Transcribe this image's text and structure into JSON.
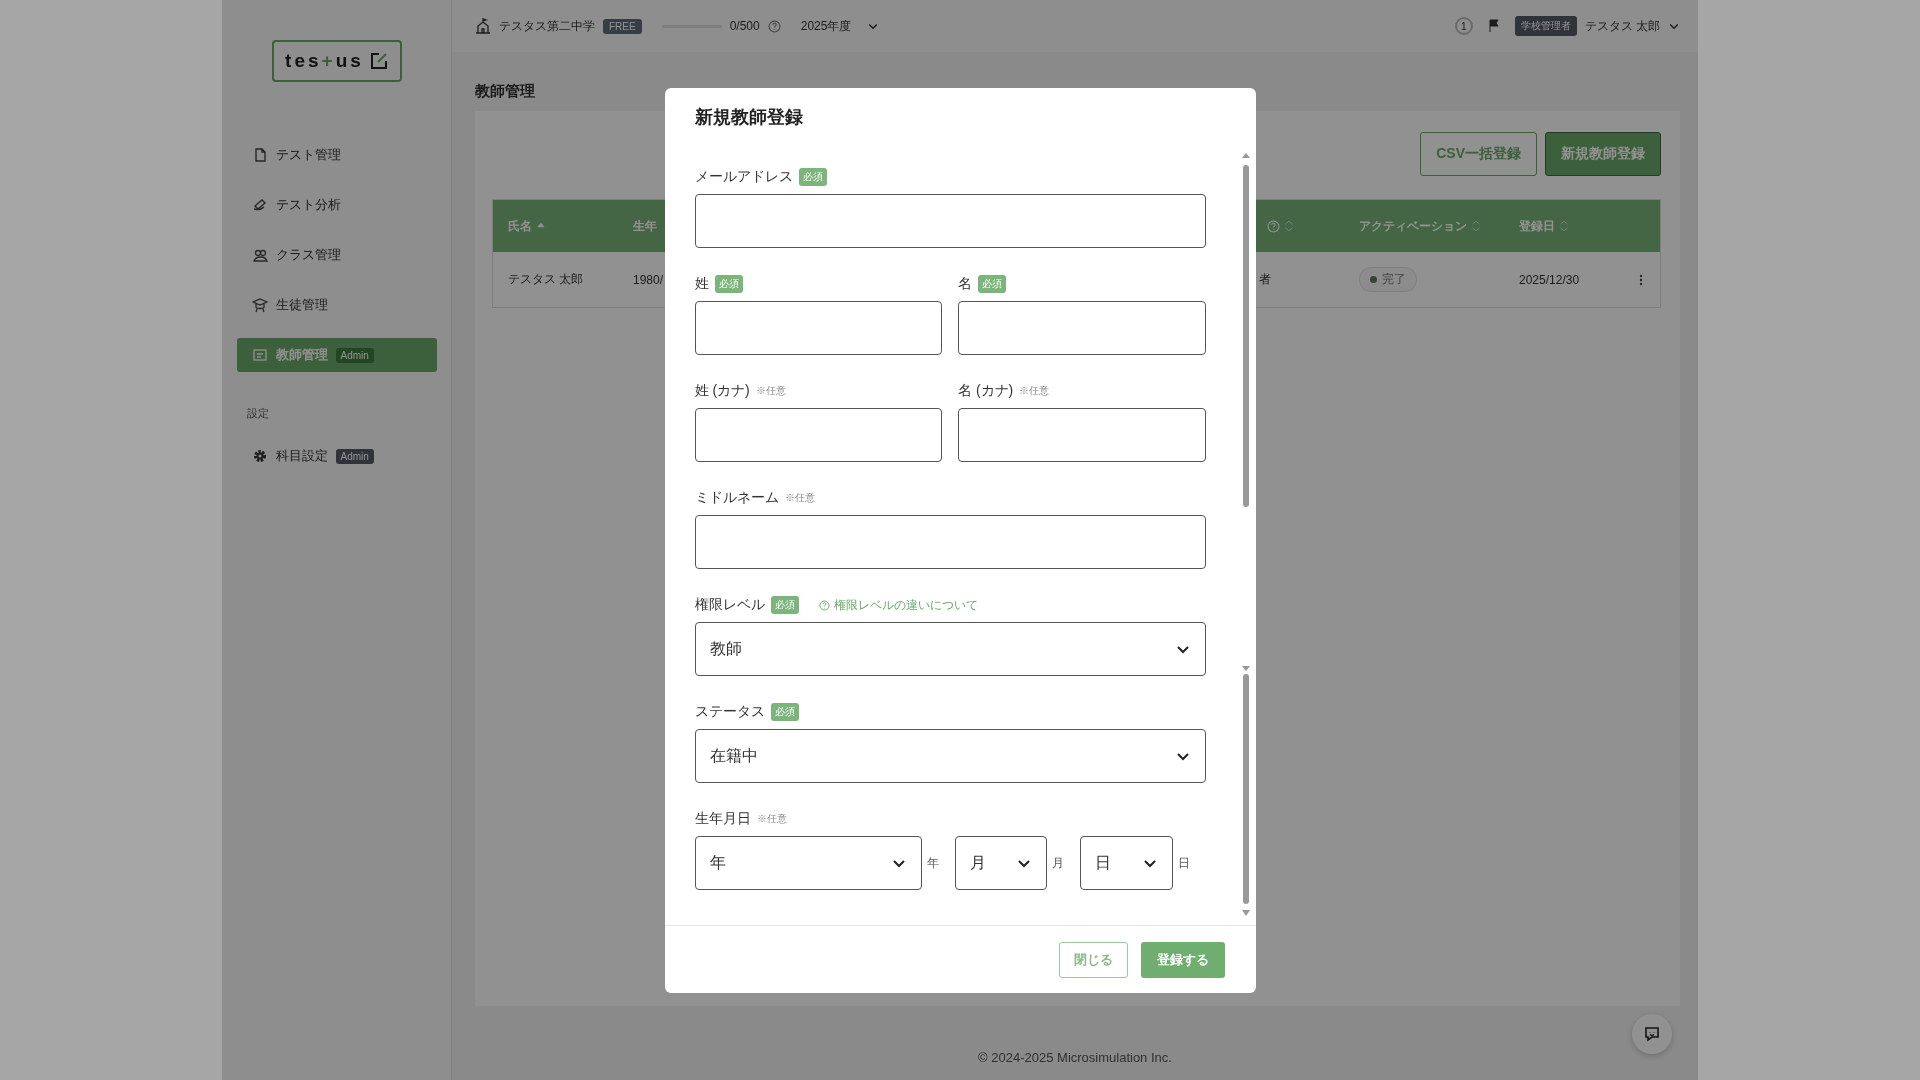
{
  "topbar": {
    "school": "テスタス第二中学",
    "plan": "FREE",
    "usage": {
      "level": 0,
      "reading": "0/500"
    },
    "year": "2025年度",
    "notifications": "1",
    "role": "学校管理者",
    "user": "テスタス 太郎"
  },
  "sidebar": {
    "logo": {
      "text": "tes",
      "accent": "+",
      "rest": "us"
    },
    "items": [
      {
        "label": "テスト管理",
        "selected": false
      },
      {
        "label": "テスト分析",
        "selected": false
      },
      {
        "label": "クラス管理",
        "selected": false
      },
      {
        "label": "生徒管理",
        "selected": false
      },
      {
        "label": "教師管理",
        "selected": true,
        "badge": "Admin"
      }
    ],
    "section": "設定",
    "settings": [
      {
        "label": "科目設定",
        "selected": false,
        "badge": "Admin"
      }
    ]
  },
  "page": {
    "title": "教師管理",
    "buttons": [
      {
        "label": "CSV一括登録",
        "kind": "secondary"
      },
      {
        "label": "新規教師登録",
        "kind": "primary"
      }
    ],
    "table": {
      "columns": [
        {
          "label": "氏名",
          "sorted": true
        },
        {
          "label": "生年"
        },
        {
          "kind": "help",
          "sorted": false
        },
        {
          "label": "アクティベーション",
          "sorted": false
        },
        {
          "label": "登録日",
          "sorted": false
        }
      ],
      "rows": [
        {
          "cells": [
            "テスタス 太郎",
            "1980/",
            "者"
          ],
          "activation": "完了",
          "date": "2025/12/30"
        }
      ]
    }
  },
  "modal": {
    "title": "新規教師登録",
    "fields": [
      {
        "kind": "text",
        "label": "メールアドレス",
        "badge": "必須"
      },
      {
        "kind": "half",
        "label": "姓",
        "badge": "必須"
      },
      {
        "kind": "half",
        "label": "名",
        "badge": "必須"
      },
      {
        "kind": "half",
        "label": "姓 (カナ)",
        "note": "※任意"
      },
      {
        "kind": "half",
        "label": "名 (カナ)",
        "note": "※任意"
      },
      {
        "kind": "text",
        "label": "ミドルネーム",
        "note": "※任意"
      },
      {
        "kind": "select",
        "label": "権限レベル",
        "badge": "必須",
        "link": "権限レベルの違いについて",
        "value": "教師"
      },
      {
        "kind": "select",
        "label": "ステータス",
        "badge": "必須",
        "value": "在籍中"
      },
      {
        "kind": "date",
        "label": "生年月日",
        "note": "※任意",
        "parts": [
          {
            "value": "年",
            "unit": "年"
          },
          {
            "value": "月",
            "unit": "月"
          },
          {
            "value": "日",
            "unit": "日"
          }
        ]
      }
    ],
    "buttons": [
      {
        "label": "閉じる",
        "kind": "secondary"
      },
      {
        "label": "登録する",
        "kind": "primary"
      }
    ]
  },
  "footer": "© 2024-2025 Microsimulation Inc."
}
